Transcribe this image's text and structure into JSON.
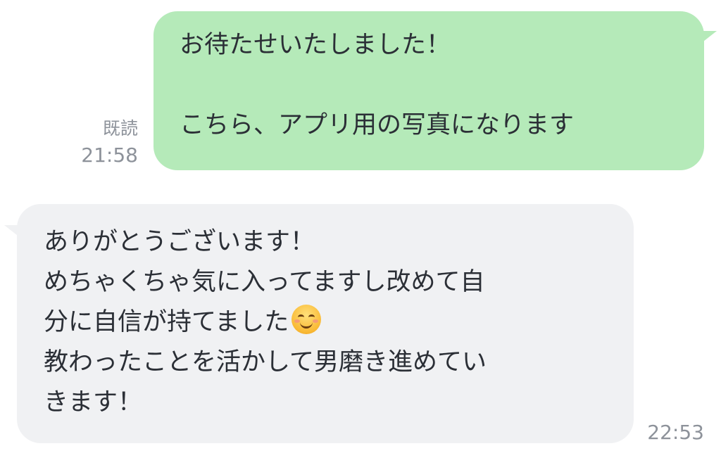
{
  "messages": {
    "outgoing": {
      "lines": [
        "お待たせいたしました！",
        "",
        "こちら、アプリ用の写真になります"
      ],
      "read_label": "既読",
      "time": "21:58",
      "bubble_color": "#b5eab9"
    },
    "incoming": {
      "lines": [
        "ありがとうございます！",
        "めちゃくちゃ気に入ってますし改めて自",
        "分に自信が持てました",
        "教わったことを活かして男磨き進めてい",
        "きます！"
      ],
      "emoji": "smiling-face-with-smiling-eyes",
      "time": "22:53",
      "bubble_color": "#f0f1f3"
    }
  }
}
